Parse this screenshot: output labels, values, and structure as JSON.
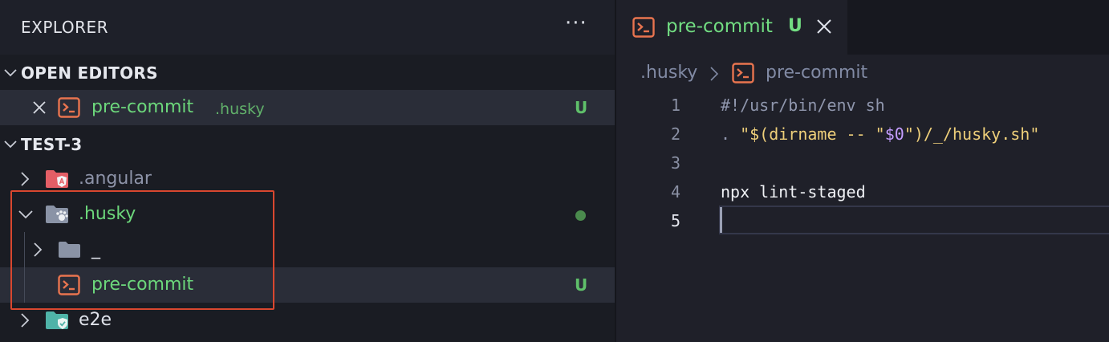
{
  "explorer": {
    "title": "EXPLORER",
    "more_actions": "···"
  },
  "open_editors": {
    "header": "OPEN EDITORS",
    "items": [
      {
        "name": "pre-commit",
        "folder": ".husky",
        "status": "U",
        "icon": "shell-script-icon"
      }
    ]
  },
  "workspace": {
    "header": "TEST-3",
    "tree": [
      {
        "name": ".angular",
        "icon": "angular-folder-icon",
        "expanded": false
      },
      {
        "name": ".husky",
        "icon": "husky-folder-icon",
        "expanded": true,
        "status": "modified-dot"
      },
      {
        "name": "_",
        "icon": "folder-icon",
        "expanded": false
      },
      {
        "name": "pre-commit",
        "icon": "shell-script-icon",
        "status": "U"
      },
      {
        "name": "e2e",
        "icon": "e2e-folder-icon",
        "expanded": false
      }
    ]
  },
  "editor": {
    "tab": {
      "name": "pre-commit",
      "status": "U",
      "icon": "shell-script-icon"
    },
    "breadcrumb": [
      ".husky",
      "pre-commit"
    ],
    "lines": [
      {
        "num": "1",
        "text": "#!/usr/bin/env sh"
      },
      {
        "num": "2",
        "p1": ". ",
        "p2": "\"$(dirname -- \"",
        "p3": "$0",
        "p4": "\")/_/husky.sh\""
      },
      {
        "num": "3",
        "text": ""
      },
      {
        "num": "4",
        "text": "npx lint-staged"
      },
      {
        "num": "5",
        "text": ""
      }
    ],
    "active_line": "5"
  },
  "colors": {
    "untracked_green": "#6cd77b",
    "shell_icon_orange": "#e8744f",
    "highlight_box_red": "#d9472f",
    "angular_red": "#e45e66",
    "e2e_teal": "#4fb3a8"
  }
}
